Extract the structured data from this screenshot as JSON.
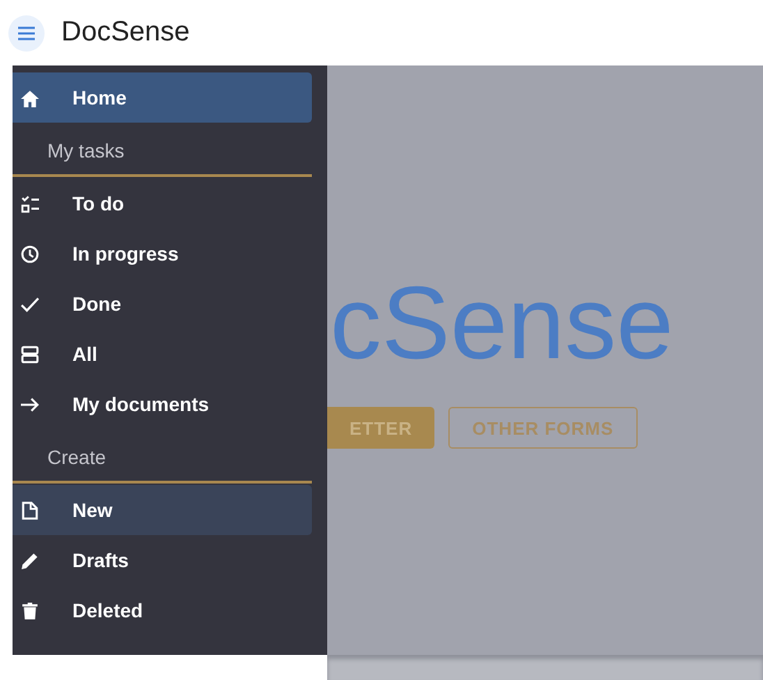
{
  "app_bar": {
    "title": "DocSense"
  },
  "drawer": {
    "items": [
      {
        "kind": "link",
        "label": "Home",
        "selected": true,
        "hovered": false
      },
      {
        "kind": "section",
        "label": "My tasks"
      },
      {
        "kind": "link",
        "label": "To do",
        "selected": false,
        "hovered": false
      },
      {
        "kind": "link",
        "label": "In progress",
        "selected": false,
        "hovered": false
      },
      {
        "kind": "link",
        "label": "Done",
        "selected": false,
        "hovered": false
      },
      {
        "kind": "link",
        "label": "All",
        "selected": false,
        "hovered": false
      },
      {
        "kind": "link",
        "label": "My documents",
        "selected": false,
        "hovered": false
      },
      {
        "kind": "section",
        "label": "Create"
      },
      {
        "kind": "link",
        "label": "New",
        "selected": false,
        "hovered": true
      },
      {
        "kind": "link",
        "label": "Drafts",
        "selected": false,
        "hovered": false
      },
      {
        "kind": "link",
        "label": "Deleted",
        "selected": false,
        "hovered": false
      }
    ]
  },
  "main": {
    "hero_title": "cSense",
    "buttons": [
      {
        "kind": "filled",
        "label": "ETTER"
      },
      {
        "kind": "outlined",
        "label": "OTHER FORMS"
      }
    ]
  }
}
